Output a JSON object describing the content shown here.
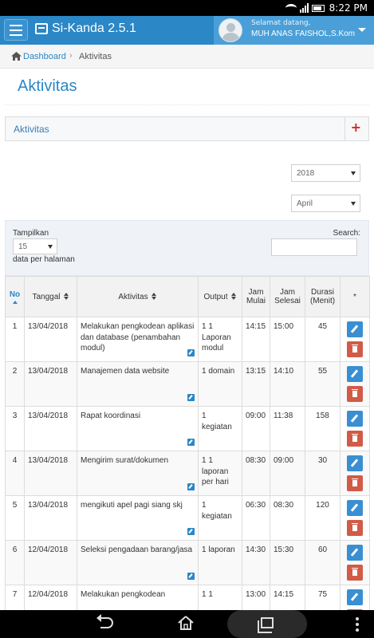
{
  "status_bar": {
    "time": "8:22 PM"
  },
  "app": {
    "title": "Si-Kanda 2.5.1"
  },
  "user": {
    "greeting": "Selamat datang,",
    "name": "MUH ANAS FAISHOL,S.Kom"
  },
  "breadcrumb": {
    "home": "Dashboard",
    "separator": "›",
    "current": "Aktivitas"
  },
  "page": {
    "title": "Aktivitas"
  },
  "widget": {
    "title": "Aktivitas",
    "add_icon": "plus-icon"
  },
  "filters": {
    "year": "2018",
    "month": "April"
  },
  "datatable": {
    "length_label": "Tampilkan",
    "length_value": "15",
    "length_suffix": "data per halaman",
    "search_label": "Search:",
    "search_value": ""
  },
  "table": {
    "headers": [
      "No",
      "Tanggal",
      "Aktivitas",
      "Output",
      "Jam Mulai",
      "Jam Selesai",
      "Durasi (Menit)",
      "*"
    ],
    "rows": [
      {
        "no": "1",
        "tanggal": "13/04/2018",
        "aktivitas": "Melakukan pengkodean aplikasi dan database (penambahan modul)",
        "output": "1 1 Laporan modul",
        "mulai": "14:15",
        "selesai": "15:00",
        "durasi": "45"
      },
      {
        "no": "2",
        "tanggal": "13/04/2018",
        "aktivitas": "Manajemen data website",
        "output": "1 domain",
        "mulai": "13:15",
        "selesai": "14:10",
        "durasi": "55"
      },
      {
        "no": "3",
        "tanggal": "13/04/2018",
        "aktivitas": "Rapat koordinasi",
        "output": "1 kegiatan",
        "mulai": "09:00",
        "selesai": "11:38",
        "durasi": "158"
      },
      {
        "no": "4",
        "tanggal": "13/04/2018",
        "aktivitas": "Mengirim surat/dokumen",
        "output": "1 1 laporan per hari",
        "mulai": "08:30",
        "selesai": "09:00",
        "durasi": "30"
      },
      {
        "no": "5",
        "tanggal": "13/04/2018",
        "aktivitas": "mengikuti apel pagi siang skj",
        "output": "1 kegiatan",
        "mulai": "06:30",
        "selesai": "08:30",
        "durasi": "120"
      },
      {
        "no": "6",
        "tanggal": "12/04/2018",
        "aktivitas": "Seleksi pengadaan barang/jasa",
        "output": "1 laporan",
        "mulai": "14:30",
        "selesai": "15:30",
        "durasi": "60"
      },
      {
        "no": "7",
        "tanggal": "12/04/2018",
        "aktivitas": "Melakukan pengkodean",
        "output": "1 1",
        "mulai": "13:00",
        "selesai": "14:15",
        "durasi": "75"
      }
    ]
  }
}
